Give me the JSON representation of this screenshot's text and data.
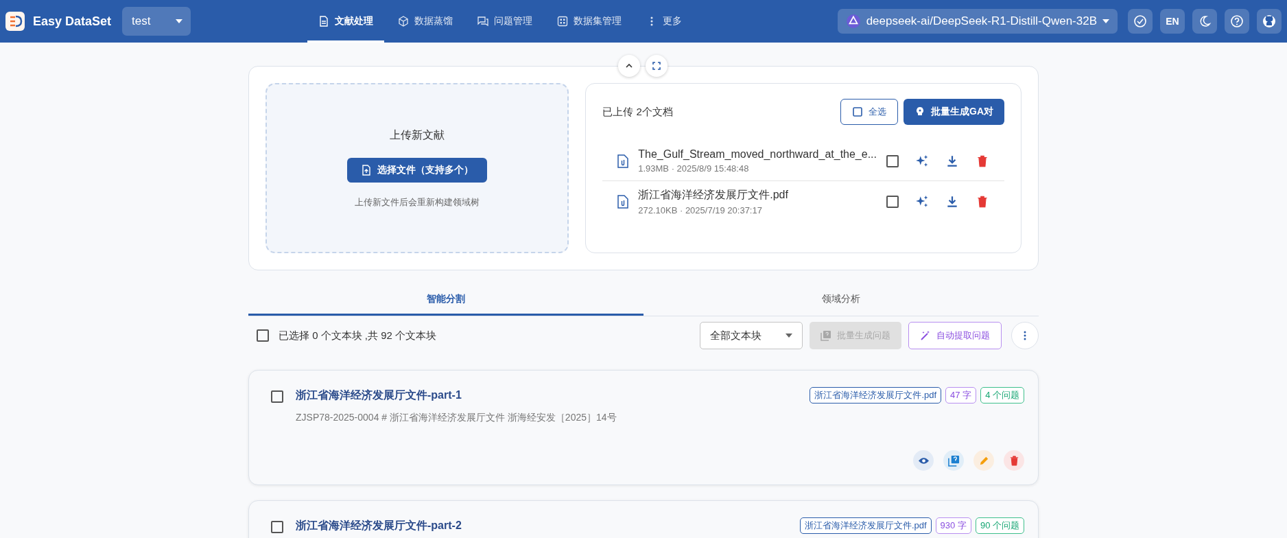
{
  "header": {
    "app_name": "Easy DataSet",
    "project": "test",
    "nav": [
      {
        "label": "文献处理",
        "kind": "document",
        "selected": true
      },
      {
        "label": "数据蒸馏",
        "kind": "cube",
        "selected": false
      },
      {
        "label": "问题管理",
        "kind": "chat",
        "selected": false
      },
      {
        "label": "数据集管理",
        "kind": "grid",
        "selected": false
      },
      {
        "label": "更多",
        "kind": "more",
        "selected": false
      }
    ],
    "model": "deepseek-ai/DeepSeek-R1-Distill-Qwen-32B",
    "language": "EN"
  },
  "upload": {
    "title": "上传新文献",
    "button": "选择文件（支持多个）",
    "hint": "上传新文件后会重新构建领域树"
  },
  "files_panel": {
    "count": "已上传 2个文档",
    "select_all": "全选",
    "batch_button": "批量生成GA对",
    "files": [
      {
        "name": "The_Gulf_Stream_moved_northward_at_the_e...",
        "meta": "1.93MB · 2025/8/9 15:48:48",
        "checked": false
      },
      {
        "name": "浙江省海洋经济发展厅文件.pdf",
        "meta": "272.10KB · 2025/7/19 20:37:17",
        "checked": false
      }
    ]
  },
  "tabs": [
    {
      "label": "智能分割",
      "selected": true
    },
    {
      "label": "领域分析",
      "selected": false
    }
  ],
  "toolbar": {
    "checked": false,
    "selection": "已选择 0 个文本块 ,共 92 个文本块",
    "filter": "全部文本块",
    "batch_questions": {
      "label": "批量生成问题",
      "disabled": true
    },
    "auto_extract": "自动提取问题"
  },
  "chunks": [
    {
      "title": "浙江省海洋经济发展厅文件-part-1",
      "checked": false,
      "preview": "ZJSP78-2025-0004 # 浙江省海洋经济发展厅文件 浙海经安发［2025］14号",
      "file_tag": "浙江省海洋经济发展厅文件.pdf",
      "chars": "47 字",
      "questions": "4 个问题"
    },
    {
      "title": "浙江省海洋经济发展厅文件-part-2",
      "checked": false,
      "file_tag": "浙江省海洋经济发展厅文件.pdf",
      "chars": "930 字",
      "questions": "90 个问题"
    }
  ]
}
